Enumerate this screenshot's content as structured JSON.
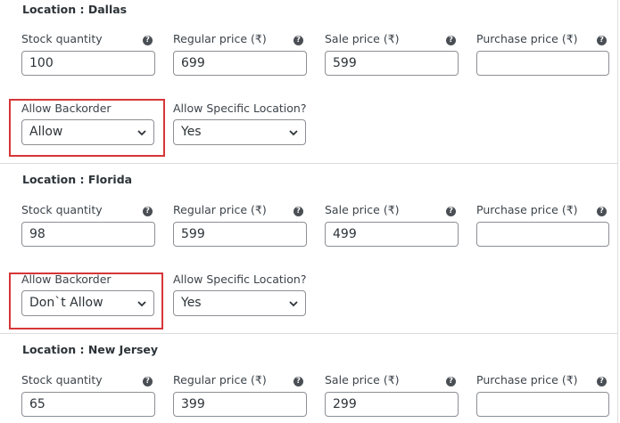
{
  "icon_names": {
    "help": "question-circle-icon",
    "chevron": "chevron-down-icon"
  },
  "colors": {
    "highlight": "#d63638",
    "help_icon": "#4a4f55"
  },
  "help_glyph": "?",
  "locations": [
    {
      "title": "Location : Dallas",
      "stock_label": "Stock quantity",
      "stock_value": "100",
      "regular_label": "Regular price (₹)",
      "regular_value": "699",
      "sale_label": "Sale price (₹)",
      "sale_value": "599",
      "purchase_label": "Purchase price (₹)",
      "purchase_value": "",
      "backorder_label": "Allow Backorder",
      "backorder_value": "Allow",
      "specific_label": "Allow Specific Location?",
      "specific_value": "Yes"
    },
    {
      "title": "Location : Florida",
      "stock_label": "Stock quantity",
      "stock_value": "98",
      "regular_label": "Regular price (₹)",
      "regular_value": "599",
      "sale_label": "Sale price (₹)",
      "sale_value": "499",
      "purchase_label": "Purchase price (₹)",
      "purchase_value": "",
      "backorder_label": "Allow Backorder",
      "backorder_value": "Don`t Allow",
      "specific_label": "Allow Specific Location?",
      "specific_value": "Yes"
    },
    {
      "title": "Location : New Jersey",
      "stock_label": "Stock quantity",
      "stock_value": "65",
      "regular_label": "Regular price (₹)",
      "regular_value": "399",
      "sale_label": "Sale price (₹)",
      "sale_value": "299",
      "purchase_label": "Purchase price (₹)",
      "purchase_value": ""
    }
  ]
}
